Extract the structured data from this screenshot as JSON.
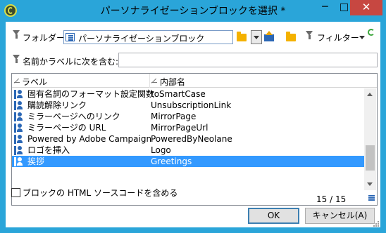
{
  "window": {
    "title": "パーソナライゼーションブロックを選択 *",
    "minimize": "─",
    "maximize": "□",
    "close": "✕"
  },
  "toolbar": {
    "folder_label": "フォルダー:",
    "folder_value": "パーソナライゼーションブロック",
    "filter_button": "フィルター"
  },
  "search": {
    "label": "名前かラベルに次を含む:",
    "value": ""
  },
  "table": {
    "columns": [
      "ラベル",
      "内部名"
    ],
    "rows": [
      {
        "label": "固有名詞のフォーマット設定関数",
        "name": "toSmartCase",
        "selected": false
      },
      {
        "label": "購読解除リンク",
        "name": "UnsubscriptionLink",
        "selected": false
      },
      {
        "label": "ミラーページへのリンク",
        "name": "MirrorPage",
        "selected": false
      },
      {
        "label": "ミラーページの URL",
        "name": "MirrorPageUrl",
        "selected": false
      },
      {
        "label": "Powered by Adobe Campaign",
        "name": "PoweredByNeolane",
        "selected": false
      },
      {
        "label": "ロゴを挿入",
        "name": "Logo",
        "selected": false
      },
      {
        "label": "挨拶",
        "name": "Greetings",
        "selected": true
      }
    ],
    "count": "15 / 15"
  },
  "options": {
    "include_html_label": "ブロックの HTML ソースコードを含める",
    "include_html_checked": false
  },
  "buttons": {
    "ok": "OK",
    "cancel": "キャンセル(A)"
  },
  "colors": {
    "titlebar": "#2aa5d9",
    "close": "#c74741",
    "selection": "#3399ff",
    "accent": "#2b67b5"
  }
}
